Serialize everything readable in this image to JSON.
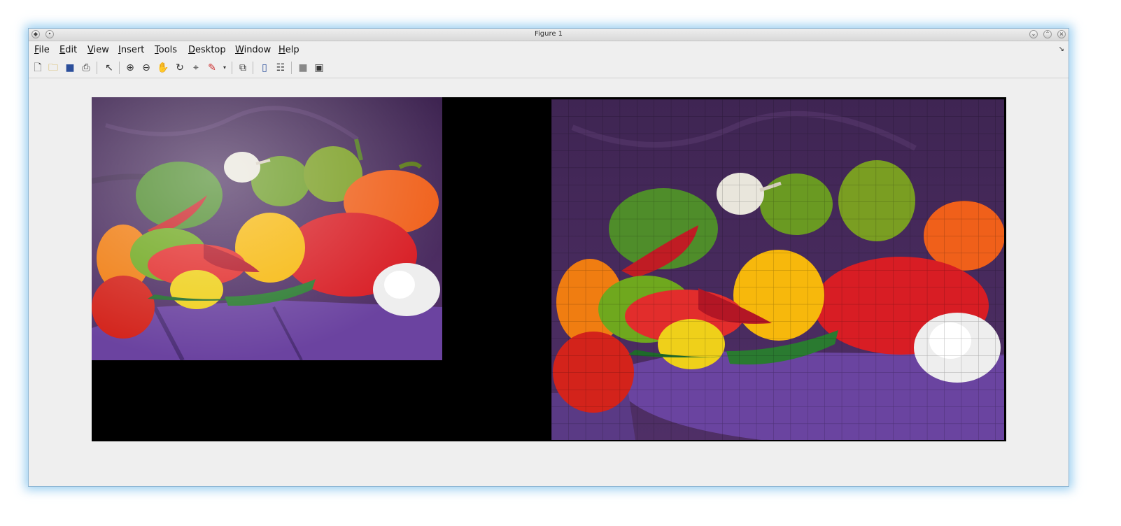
{
  "window": {
    "title": "Figure 1"
  },
  "menu": {
    "items": [
      {
        "u": "F",
        "rest": "ile"
      },
      {
        "u": "E",
        "rest": "dit"
      },
      {
        "u": "V",
        "rest": "iew"
      },
      {
        "u": "I",
        "rest": "nsert"
      },
      {
        "u": "T",
        "rest": "ools"
      },
      {
        "u": "D",
        "rest": "esktop"
      },
      {
        "u": "W",
        "rest": "indow"
      },
      {
        "u": "H",
        "rest": "elp"
      }
    ]
  },
  "toolbar": {
    "icons": [
      "new-figure-icon",
      "open-file-icon",
      "save-icon",
      "print-icon",
      "edit-plot-icon",
      "zoom-in-icon",
      "zoom-out-icon",
      "pan-icon",
      "rotate-3d-icon",
      "data-cursor-icon",
      "brush-icon",
      "link-plot-icon",
      "colorbar-icon",
      "legend-icon",
      "hide-plot-tools-icon",
      "show-plot-tools-icon"
    ]
  },
  "colors": {
    "background_cloth": "#4a2b5e",
    "axes_background": "#000000",
    "window_bg": "#efefef"
  }
}
